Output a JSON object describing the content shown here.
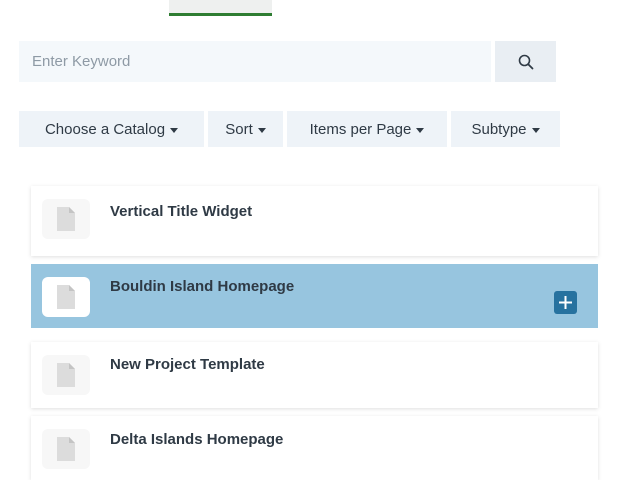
{
  "search": {
    "placeholder": "Enter Keyword",
    "value": "",
    "button_icon": "search-icon"
  },
  "filters": [
    {
      "label": "Choose a Catalog",
      "icon": "caret-down-icon"
    },
    {
      "label": "Sort",
      "icon": "caret-down-icon"
    },
    {
      "label": "Items per Page",
      "icon": "caret-down-icon"
    },
    {
      "label": "Subtype",
      "icon": "caret-down-icon"
    }
  ],
  "items": [
    {
      "title": "Vertical Title Widget",
      "icon": "document-icon",
      "selected": false
    },
    {
      "title": "Bouldin Island Homepage",
      "icon": "document-icon",
      "selected": true,
      "action_icon": "plus-icon"
    },
    {
      "title": "New Project Template",
      "icon": "document-icon",
      "selected": false
    },
    {
      "title": "Delta Islands Homepage",
      "icon": "document-icon",
      "selected": false
    }
  ],
  "colors": {
    "accent_underline": "#2e7d32",
    "selected_row": "#97c5df",
    "add_button": "#27729f",
    "control_background": "#eef3f8"
  }
}
